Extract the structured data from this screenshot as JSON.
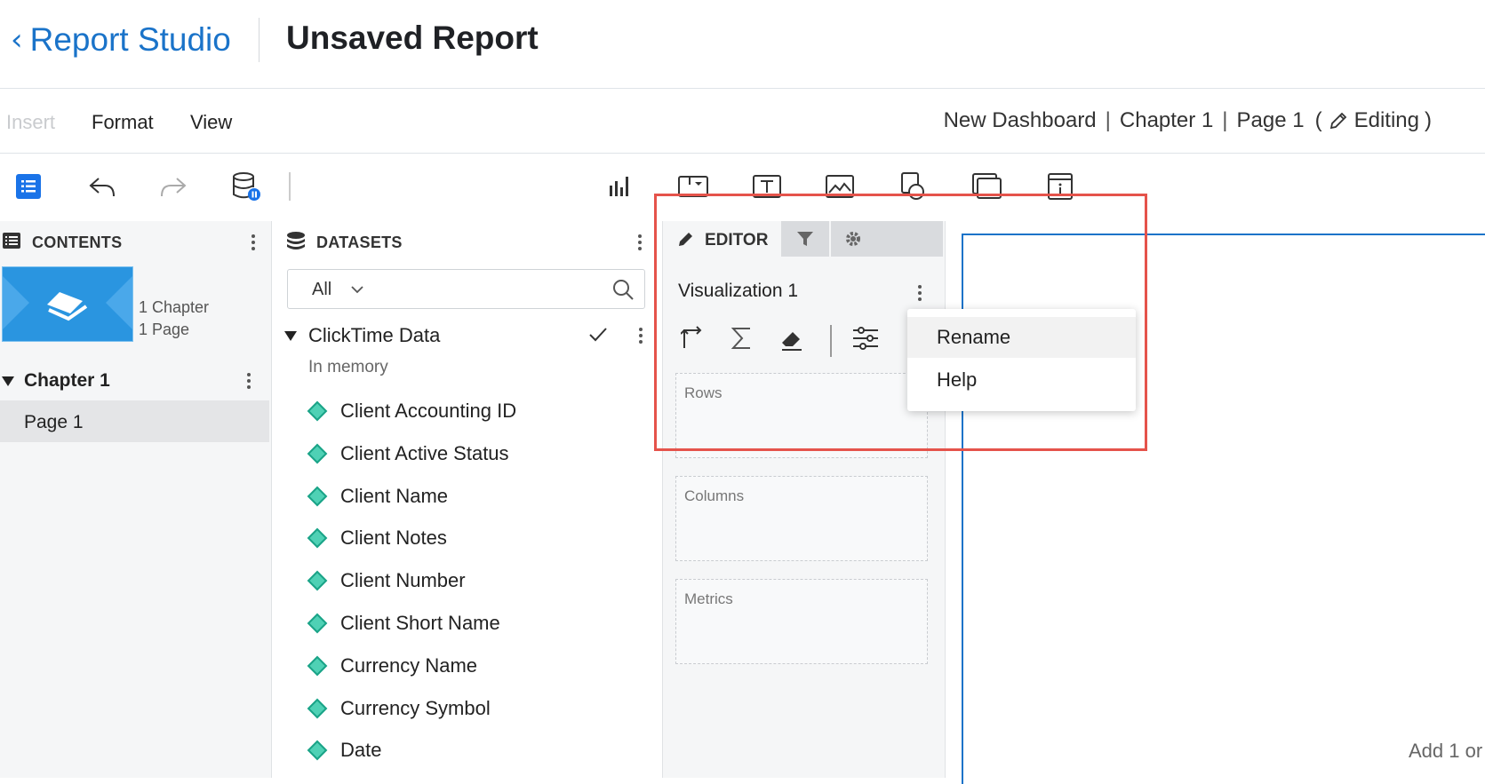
{
  "header": {
    "back_label": "Report Studio",
    "report_title": "Unsaved Report"
  },
  "menubar": {
    "items": [
      "Insert",
      "Format",
      "View"
    ],
    "breadcrumb": {
      "dashboard": "New Dashboard",
      "chapter": "Chapter 1",
      "page": "Page 1",
      "mode_open": "(",
      "mode": "Editing",
      "mode_close": ")",
      "separator": "|"
    }
  },
  "contents": {
    "title": "CONTENTS",
    "summary": [
      "1 Chapter",
      "1 Page"
    ],
    "chapter": "Chapter 1",
    "page": "Page 1"
  },
  "datasets": {
    "title": "DATASETS",
    "filter_value": "All",
    "dataset_name": "ClickTime Data",
    "dataset_status": "In memory",
    "fields": [
      "Client Accounting ID",
      "Client Active Status",
      "Client Name",
      "Client Notes",
      "Client Number",
      "Client Short Name",
      "Currency Name",
      "Currency Symbol",
      "Date"
    ]
  },
  "editor": {
    "tab_label": "EDITOR",
    "viz_title": "Visualization 1",
    "zones": {
      "rows": "Rows",
      "columns": "Columns",
      "metrics": "Metrics"
    }
  },
  "context_menu": {
    "items": [
      "Rename",
      "Help"
    ]
  },
  "canvas": {
    "hint": "Add 1 or"
  },
  "colors": {
    "accent": "#1a73c9",
    "highlight": "#e5534b",
    "field_icon": "#4fd1b5"
  }
}
